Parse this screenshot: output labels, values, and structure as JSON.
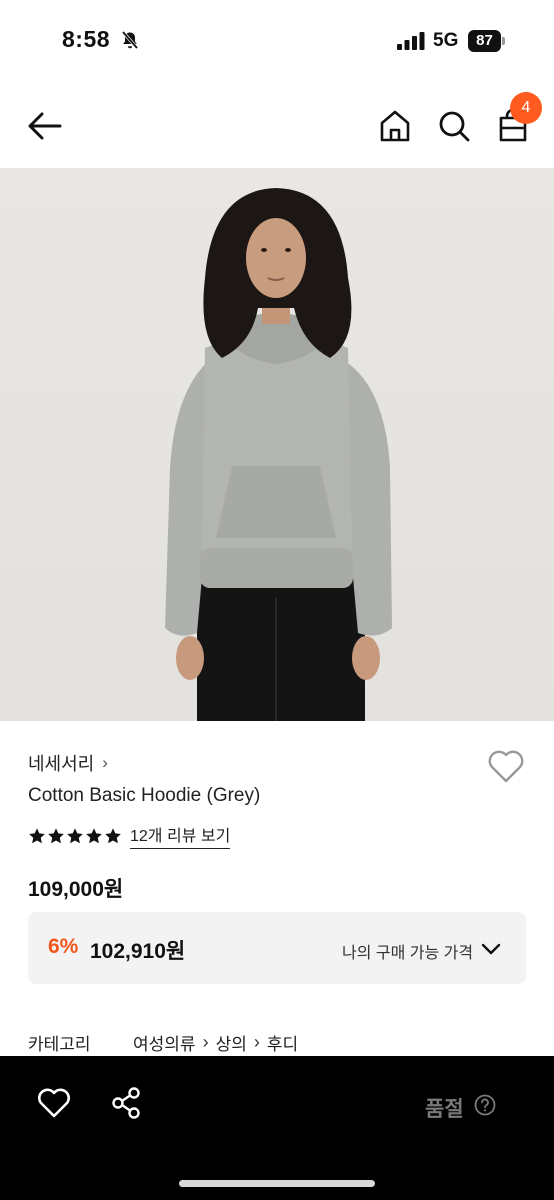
{
  "status_bar": {
    "time": "8:58",
    "network": "5G",
    "battery": "87",
    "icons": [
      "bell-slash-icon",
      "signal-icon"
    ]
  },
  "header": {
    "icons": [
      "back-arrow-icon",
      "home-icon",
      "search-icon",
      "shopping-bag-icon"
    ],
    "cart_count": "4",
    "badge_color": "#ff5a1f"
  },
  "product": {
    "brand": "네세서리",
    "brand_chevron": "›",
    "title": "Cotton Basic Hoodie (Grey)",
    "rating": 5,
    "rating_max": 5,
    "review_link": "12개 리뷰 보기",
    "price": "109,000원",
    "discount": {
      "rate": "6%",
      "price": "102,910원",
      "my_price_label": "나의 구매 가능 가격",
      "accent_color": "#f0561d"
    },
    "category": {
      "label": "카테고리",
      "path": [
        "여성의류",
        "상의",
        "후디"
      ],
      "separator": "›"
    }
  },
  "bottom_bar": {
    "icons": [
      "heart-outline-icon",
      "share-icon",
      "question-circle-icon"
    ],
    "status_label": "품절"
  }
}
